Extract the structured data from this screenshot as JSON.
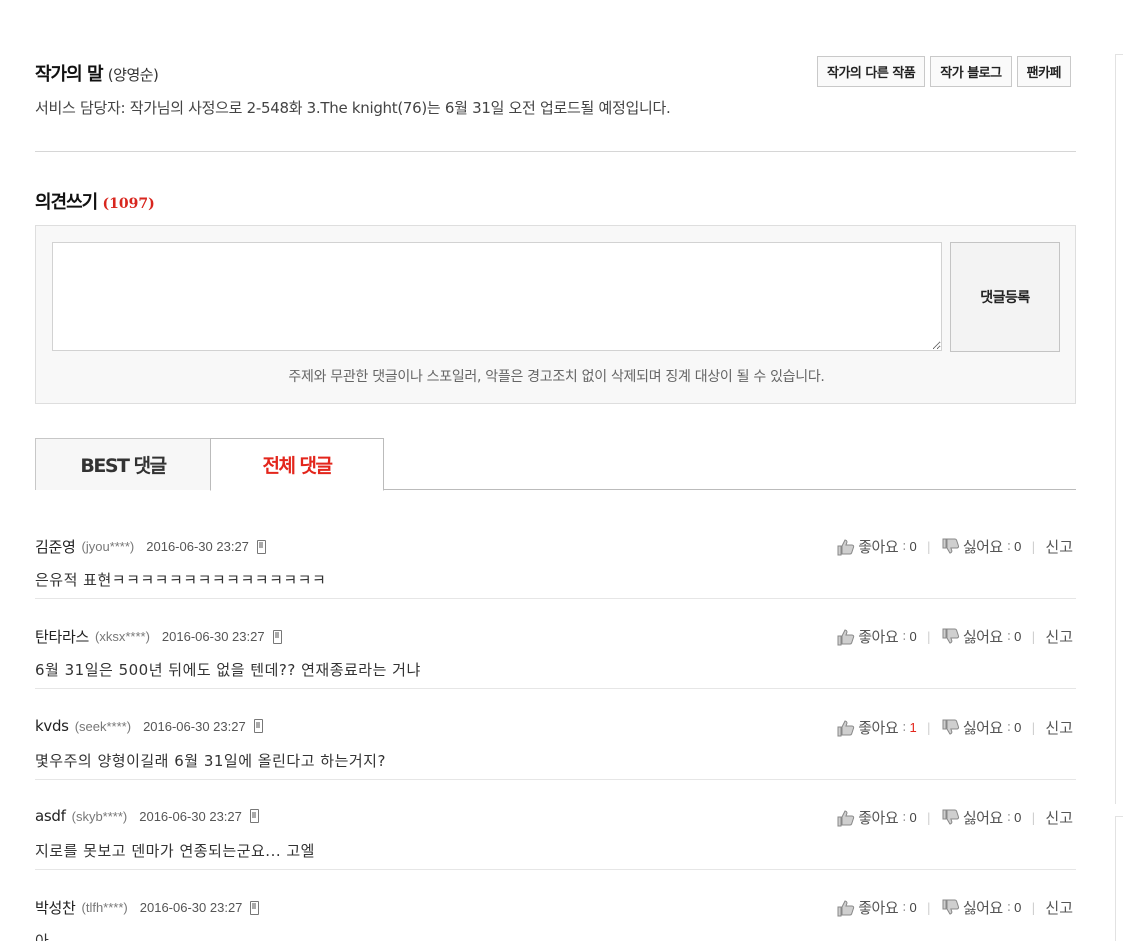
{
  "author": {
    "title": "작가의 말",
    "name": "(양영순)",
    "buttons": [
      "작가의 다른 작품",
      "작가 블로그",
      "팬카페"
    ],
    "notice": "서비스 담당자: 작가님의 사정으로 2-548화 3.The knight(76)는 6월 31일 오전 업로드될 예정입니다."
  },
  "write": {
    "title": "의견쓰기",
    "count": "(1097)",
    "submit_label": "댓글등록",
    "warning": "주제와 무관한 댓글이나 스포일러, 악플은 경고조치 없이 삭제되며 징계 대상이 될 수 있습니다."
  },
  "tabs": {
    "best": "BEST 댓글",
    "all": "전체 댓글"
  },
  "labels": {
    "like": "좋아요",
    "dislike": "싫어요",
    "report": "신고",
    "colon": ":",
    "sep": "|"
  },
  "comments": [
    {
      "nick": "김준영",
      "id": "(jyou****)",
      "date": "2016-06-30 23:27",
      "text": "은유적 표현ㅋㅋㅋㅋㅋㅋㅋㅋㅋㅋㅋㅋㅋㅋㅋ",
      "likes": "0",
      "dislikes": "0"
    },
    {
      "nick": "탄타라스",
      "id": "(xksx****)",
      "date": "2016-06-30 23:27",
      "text": "6월 31일은 500년 뒤에도 없을 텐데?? 연재종료라는 거냐",
      "likes": "0",
      "dislikes": "0"
    },
    {
      "nick": "kvds",
      "id": "(seek****)",
      "date": "2016-06-30 23:27",
      "text": "몇우주의 양형이길래 6월 31일에 올린다고 하는거지?",
      "likes": "1",
      "dislikes": "0"
    },
    {
      "nick": "asdf",
      "id": "(skyb****)",
      "date": "2016-06-30 23:27",
      "text": "지로를 못보고 덴마가 연종되는군요... 고엘",
      "likes": "0",
      "dislikes": "0"
    },
    {
      "nick": "박성찬",
      "id": "(tlfh****)",
      "date": "2016-06-30 23:27",
      "text": "아....",
      "likes": "0",
      "dislikes": "0"
    }
  ],
  "colors": {
    "accent_red": "#e3261c",
    "count_red": "#d8261e"
  },
  "icons": {
    "like": "thumbs-up-icon",
    "dislike": "thumbs-down-icon",
    "mobile": "mobile-phone-icon"
  }
}
